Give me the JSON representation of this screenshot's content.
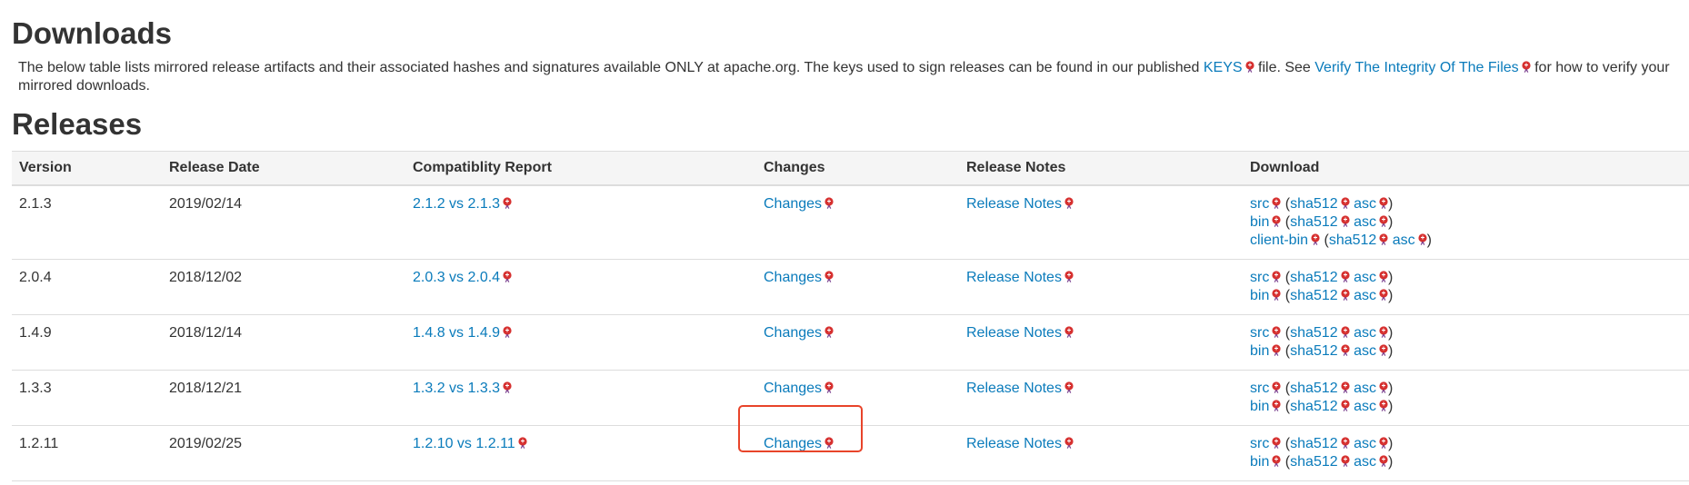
{
  "downloads": {
    "title": "Downloads",
    "intro_part1": "The below table lists mirrored release artifacts and their associated hashes and signatures available ONLY at apache.org. The keys used to sign releases can be found in our published ",
    "keys_link": "KEYS",
    "intro_part2": " file. See ",
    "verify_link": "Verify The Integrity Of The Files",
    "intro_part3": " for how to verify your mirrored downloads."
  },
  "releases": {
    "title": "Releases",
    "columns": [
      "Version",
      "Release Date",
      "Compatiblity Report",
      "Changes",
      "Release Notes",
      "Download"
    ],
    "rows": [
      {
        "version": "2.1.3",
        "date": "2019/02/14",
        "compat": "2.1.2 vs 2.1.3",
        "changes": "Changes",
        "notes": "Release Notes",
        "downloads": [
          {
            "name": "src",
            "sha": "sha512",
            "asc": "asc"
          },
          {
            "name": "bin",
            "sha": "sha512",
            "asc": "asc"
          },
          {
            "name": "client-bin",
            "sha": "sha512",
            "asc": "asc"
          }
        ]
      },
      {
        "version": "2.0.4",
        "date": "2018/12/02",
        "compat": "2.0.3 vs 2.0.4",
        "changes": "Changes",
        "notes": "Release Notes",
        "downloads": [
          {
            "name": "src",
            "sha": "sha512",
            "asc": "asc"
          },
          {
            "name": "bin",
            "sha": "sha512",
            "asc": "asc"
          }
        ]
      },
      {
        "version": "1.4.9",
        "date": "2018/12/14",
        "compat": "1.4.8 vs 1.4.9",
        "changes": "Changes",
        "notes": "Release Notes",
        "downloads": [
          {
            "name": "src",
            "sha": "sha512",
            "asc": "asc"
          },
          {
            "name": "bin",
            "sha": "sha512",
            "asc": "asc"
          }
        ]
      },
      {
        "version": "1.3.3",
        "date": "2018/12/21",
        "compat": "1.3.2 vs 1.3.3",
        "changes": "Changes",
        "notes": "Release Notes",
        "downloads": [
          {
            "name": "src",
            "sha": "sha512",
            "asc": "asc"
          },
          {
            "name": "bin",
            "sha": "sha512",
            "asc": "asc"
          }
        ]
      },
      {
        "version": "1.2.11",
        "date": "2019/02/25",
        "compat": "1.2.10 vs 1.2.11",
        "changes": "Changes",
        "notes": "Release Notes",
        "downloads": [
          {
            "name": "src",
            "sha": "sha512",
            "asc": "asc"
          },
          {
            "name": "bin",
            "sha": "sha512",
            "asc": "asc"
          }
        ]
      }
    ]
  },
  "colors": {
    "link": "#0a7bbb",
    "highlight": "#e8442a"
  },
  "icons": {
    "external": "external-link-icon"
  }
}
